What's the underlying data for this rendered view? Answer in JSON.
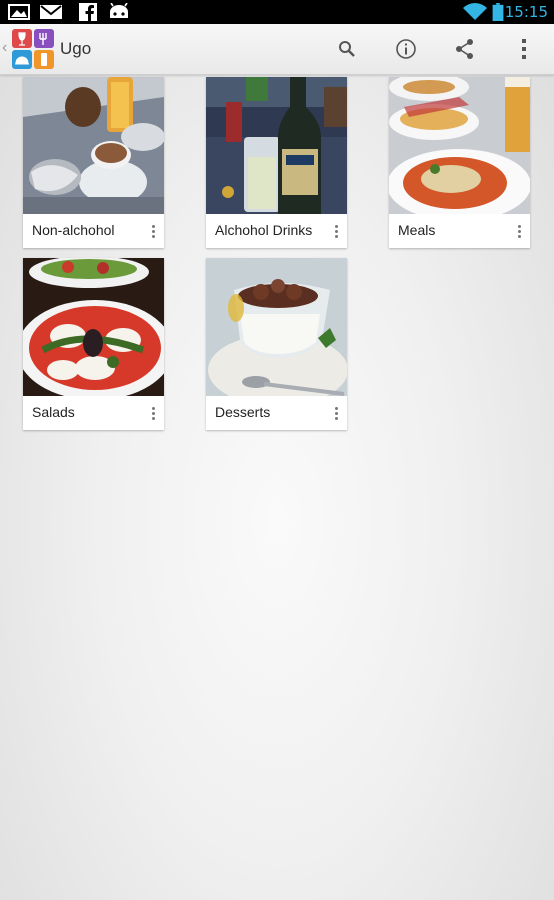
{
  "status_bar": {
    "time": "15:15",
    "left_icons": [
      "picture-icon",
      "gmail-icon",
      "facebook-icon",
      "android-icon"
    ],
    "right_icons": [
      "wifi-icon",
      "battery-icon"
    ],
    "accent": "#33b5e5"
  },
  "action_bar": {
    "up_indicator": "‹",
    "title": "Ugo",
    "actions": [
      "search-icon",
      "info-icon",
      "share-icon",
      "overflow-menu-icon"
    ]
  },
  "categories": [
    {
      "label": "Non-alchohol",
      "image": "coffee-and-juice-photo"
    },
    {
      "label": "Alchohol Drinks",
      "image": "beer-bottle-photo"
    },
    {
      "label": "Meals",
      "image": "pasta-plate-photo"
    },
    {
      "label": "Salads",
      "image": "caprese-salad-photo"
    },
    {
      "label": "Desserts",
      "image": "dessert-cup-photo"
    }
  ]
}
